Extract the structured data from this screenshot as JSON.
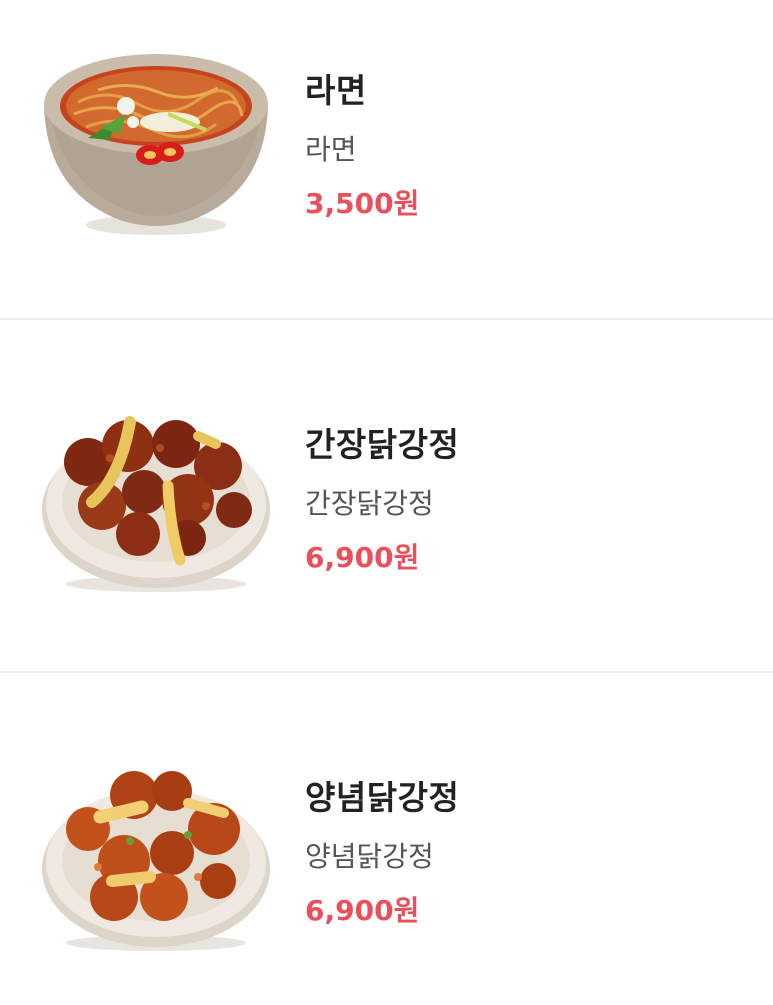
{
  "menu": {
    "items": [
      {
        "name": "라면",
        "description": "라면",
        "price": "3,500원",
        "image_icon": "ramen-bowl-icon"
      },
      {
        "name": "간장닭강정",
        "description": "간장닭강정",
        "price": "6,900원",
        "image_icon": "soy-chicken-plate-icon"
      },
      {
        "name": "양념닭강정",
        "description": "양념닭강정",
        "price": "6,900원",
        "image_icon": "spicy-chicken-plate-icon"
      }
    ]
  },
  "colors": {
    "price": "#e8505b",
    "name": "#222222",
    "description": "#555555",
    "divider": "#ececec"
  }
}
